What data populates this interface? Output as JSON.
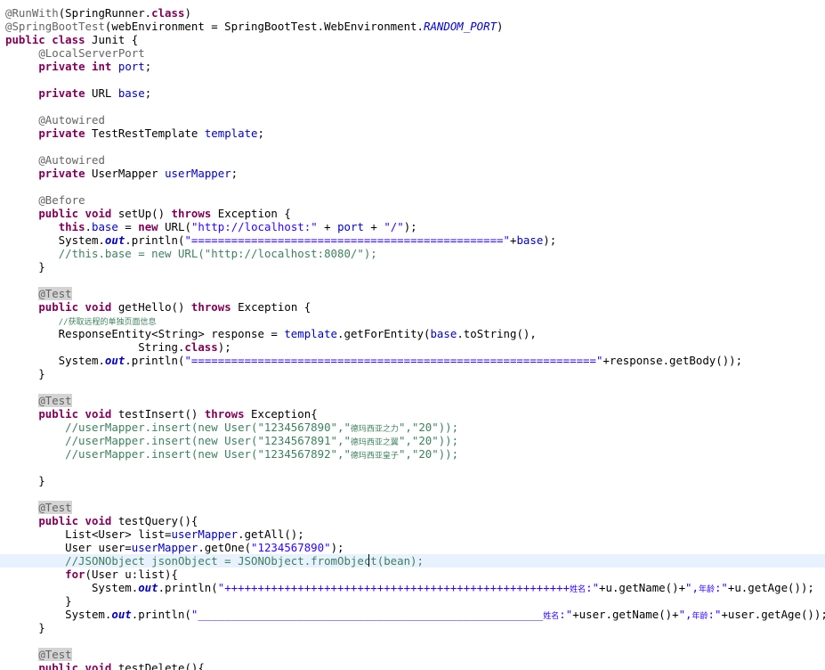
{
  "editor": {
    "lines": [
      [
        {
          "t": "@RunWith",
          "c": "an"
        },
        {
          "t": "(SpringRunner.",
          "c": "pl"
        },
        {
          "t": "class",
          "c": "kw"
        },
        {
          "t": ")",
          "c": "pl"
        }
      ],
      [
        {
          "t": "@SpringBootTest",
          "c": "an"
        },
        {
          "t": "(webEnvironment = SpringBootTest.WebEnvironment.",
          "c": "pl"
        },
        {
          "t": "RANDOM_PORT",
          "c": "sfi"
        },
        {
          "t": ")",
          "c": "pl"
        }
      ],
      [
        {
          "t": "public",
          "c": "kw"
        },
        {
          "t": " ",
          "c": "pl"
        },
        {
          "t": "class",
          "c": "kw"
        },
        {
          "t": " Junit {",
          "c": "pl"
        }
      ],
      [
        {
          "t": "     ",
          "c": "pl"
        },
        {
          "t": "@LocalServerPort",
          "c": "an"
        }
      ],
      [
        {
          "t": "     ",
          "c": "pl"
        },
        {
          "t": "private",
          "c": "kw"
        },
        {
          "t": " ",
          "c": "pl"
        },
        {
          "t": "int",
          "c": "kw"
        },
        {
          "t": " ",
          "c": "pl"
        },
        {
          "t": "port",
          "c": "fld"
        },
        {
          "t": ";",
          "c": "pl"
        }
      ],
      [],
      [
        {
          "t": "     ",
          "c": "pl"
        },
        {
          "t": "private",
          "c": "kw"
        },
        {
          "t": " URL ",
          "c": "pl"
        },
        {
          "t": "base",
          "c": "fld"
        },
        {
          "t": ";",
          "c": "pl"
        }
      ],
      [],
      [
        {
          "t": "     ",
          "c": "pl"
        },
        {
          "t": "@Autowired",
          "c": "an"
        }
      ],
      [
        {
          "t": "     ",
          "c": "pl"
        },
        {
          "t": "private",
          "c": "kw"
        },
        {
          "t": " TestRestTemplate ",
          "c": "pl"
        },
        {
          "t": "template",
          "c": "fld"
        },
        {
          "t": ";",
          "c": "pl"
        }
      ],
      [],
      [
        {
          "t": "     ",
          "c": "pl"
        },
        {
          "t": "@Autowired",
          "c": "an"
        }
      ],
      [
        {
          "t": "     ",
          "c": "pl"
        },
        {
          "t": "private",
          "c": "kw"
        },
        {
          "t": " UserMapper ",
          "c": "pl"
        },
        {
          "t": "userMapper",
          "c": "fld"
        },
        {
          "t": ";",
          "c": "pl"
        }
      ],
      [],
      [
        {
          "t": "     ",
          "c": "pl"
        },
        {
          "t": "@Before",
          "c": "an"
        }
      ],
      [
        {
          "t": "     ",
          "c": "pl"
        },
        {
          "t": "public",
          "c": "kw"
        },
        {
          "t": " ",
          "c": "pl"
        },
        {
          "t": "void",
          "c": "kw"
        },
        {
          "t": " setUp() ",
          "c": "pl"
        },
        {
          "t": "throws",
          "c": "kw"
        },
        {
          "t": " Exception {",
          "c": "pl"
        }
      ],
      [
        {
          "t": "        ",
          "c": "pl"
        },
        {
          "t": "this",
          "c": "kw"
        },
        {
          "t": ".",
          "c": "pl"
        },
        {
          "t": "base",
          "c": "fld"
        },
        {
          "t": " = ",
          "c": "pl"
        },
        {
          "t": "new",
          "c": "kw"
        },
        {
          "t": " URL(",
          "c": "pl"
        },
        {
          "t": "\"http://localhost:\"",
          "c": "str"
        },
        {
          "t": " + ",
          "c": "pl"
        },
        {
          "t": "port",
          "c": "fld"
        },
        {
          "t": " + ",
          "c": "pl"
        },
        {
          "t": "\"/\"",
          "c": "str"
        },
        {
          "t": ");",
          "c": "pl"
        }
      ],
      [
        {
          "t": "        System.",
          "c": "pl"
        },
        {
          "t": "out",
          "c": "sfld"
        },
        {
          "t": ".println(",
          "c": "pl"
        },
        {
          "t": "\"===============================================\"",
          "c": "str"
        },
        {
          "t": "+",
          "c": "pl"
        },
        {
          "t": "base",
          "c": "fld"
        },
        {
          "t": ");",
          "c": "pl"
        }
      ],
      [
        {
          "t": "        ",
          "c": "pl"
        },
        {
          "t": "//this.base = new URL(\"http://localhost:8080/\");",
          "c": "com"
        }
      ],
      [
        {
          "t": "     }",
          "c": "pl"
        }
      ],
      [],
      [
        {
          "t": "     ",
          "c": "pl"
        },
        {
          "t": "@Test",
          "c": "an-hl"
        }
      ],
      [
        {
          "t": "     ",
          "c": "pl"
        },
        {
          "t": "public",
          "c": "kw"
        },
        {
          "t": " ",
          "c": "pl"
        },
        {
          "t": "void",
          "c": "kw"
        },
        {
          "t": " getHello() ",
          "c": "pl"
        },
        {
          "t": "throws",
          "c": "kw"
        },
        {
          "t": " Exception {",
          "c": "pl"
        }
      ],
      [
        {
          "t": "        ",
          "c": "pl"
        },
        {
          "t": "//获取远程的单独页面信息",
          "c": "com",
          "s": "cjk"
        }
      ],
      [
        {
          "t": "        ResponseEntity<String> ",
          "c": "pl"
        },
        {
          "t": "response",
          "c": "pl"
        },
        {
          "t": " = ",
          "c": "pl"
        },
        {
          "t": "template",
          "c": "fld"
        },
        {
          "t": ".getForEntity(",
          "c": "pl"
        },
        {
          "t": "base",
          "c": "fld"
        },
        {
          "t": ".toString(),",
          "c": "pl"
        }
      ],
      [
        {
          "t": "                    String.",
          "c": "pl"
        },
        {
          "t": "class",
          "c": "kw"
        },
        {
          "t": ");",
          "c": "pl"
        }
      ],
      [
        {
          "t": "        System.",
          "c": "pl"
        },
        {
          "t": "out",
          "c": "sfld"
        },
        {
          "t": ".println(",
          "c": "pl"
        },
        {
          "t": "\"=============================================================\"",
          "c": "str"
        },
        {
          "t": "+",
          "c": "pl"
        },
        {
          "t": "response",
          "c": "pl"
        },
        {
          "t": ".getBody());",
          "c": "pl"
        }
      ],
      [
        {
          "t": "     }",
          "c": "pl"
        }
      ],
      [],
      [
        {
          "t": "     ",
          "c": "pl"
        },
        {
          "t": "@Test",
          "c": "an-hl"
        }
      ],
      [
        {
          "t": "     ",
          "c": "pl"
        },
        {
          "t": "public",
          "c": "kw"
        },
        {
          "t": " ",
          "c": "pl"
        },
        {
          "t": "void",
          "c": "kw"
        },
        {
          "t": " testInsert() ",
          "c": "pl"
        },
        {
          "t": "throws",
          "c": "kw"
        },
        {
          "t": " Exception{",
          "c": "pl"
        }
      ],
      [
        {
          "t": "         ",
          "c": "pl"
        },
        {
          "t": "//userMapper.insert(new User(\"1234567890\",\"",
          "c": "com"
        },
        {
          "t": "德玛西亚之力",
          "c": "com",
          "s": "cjk"
        },
        {
          "t": "\",\"20\"));",
          "c": "com"
        }
      ],
      [
        {
          "t": "         ",
          "c": "pl"
        },
        {
          "t": "//userMapper.insert(new User(\"1234567891\",\"",
          "c": "com"
        },
        {
          "t": "德玛西亚之翼",
          "c": "com",
          "s": "cjk"
        },
        {
          "t": "\",\"20\"));",
          "c": "com"
        }
      ],
      [
        {
          "t": "         ",
          "c": "pl"
        },
        {
          "t": "//userMapper.insert(new User(\"1234567892\",\"",
          "c": "com"
        },
        {
          "t": "德玛西亚皇子",
          "c": "com",
          "s": "cjk"
        },
        {
          "t": "\",\"20\"));",
          "c": "com"
        }
      ],
      [],
      [
        {
          "t": "     }",
          "c": "pl"
        }
      ],
      [],
      [
        {
          "t": "     ",
          "c": "pl"
        },
        {
          "t": "@Test",
          "c": "an-hl"
        }
      ],
      [
        {
          "t": "     ",
          "c": "pl"
        },
        {
          "t": "public",
          "c": "kw"
        },
        {
          "t": " ",
          "c": "pl"
        },
        {
          "t": "void",
          "c": "kw"
        },
        {
          "t": " testQuery(){",
          "c": "pl"
        }
      ],
      [
        {
          "t": "         List<User> ",
          "c": "pl"
        },
        {
          "t": "list",
          "c": "pl"
        },
        {
          "t": "=",
          "c": "pl"
        },
        {
          "t": "userMapper",
          "c": "fld"
        },
        {
          "t": ".getAll();",
          "c": "pl"
        }
      ],
      [
        {
          "t": "         User ",
          "c": "pl"
        },
        {
          "t": "user",
          "c": "pl"
        },
        {
          "t": "=",
          "c": "pl"
        },
        {
          "t": "userMapper",
          "c": "fld"
        },
        {
          "t": ".getOne(",
          "c": "pl"
        },
        {
          "t": "\"1234567890\"",
          "c": "str"
        },
        {
          "t": ");",
          "c": "pl"
        }
      ],
      [
        {
          "t": "         ",
          "c": "pl"
        },
        {
          "t": "//JSONObject jsonObject = JSONObject.fromObject(bean);",
          "c": "com"
        }
      ],
      [
        {
          "t": "         ",
          "c": "pl"
        },
        {
          "t": "for",
          "c": "kw"
        },
        {
          "t": "(User u:list){",
          "c": "pl"
        }
      ],
      [
        {
          "t": "             System.",
          "c": "pl"
        },
        {
          "t": "out",
          "c": "sfld"
        },
        {
          "t": ".println(",
          "c": "pl"
        },
        {
          "t": "\"++++++++++++++++++++++++++++++++++++++++++++++++++++",
          "c": "str"
        },
        {
          "t": "姓名",
          "c": "str",
          "s": "cjk"
        },
        {
          "t": ":\"",
          "c": "str"
        },
        {
          "t": "+u.getName()+",
          "c": "pl"
        },
        {
          "t": "\",",
          "c": "str"
        },
        {
          "t": "年龄",
          "c": "str",
          "s": "cjk"
        },
        {
          "t": ":\"",
          "c": "str"
        },
        {
          "t": "+u.getAge());",
          "c": "pl"
        }
      ],
      [
        {
          "t": "         }",
          "c": "pl"
        }
      ],
      [
        {
          "t": "         System.",
          "c": "pl"
        },
        {
          "t": "out",
          "c": "sfld"
        },
        {
          "t": ".println(",
          "c": "pl"
        },
        {
          "t": "\"____________________________________________________",
          "c": "str"
        },
        {
          "t": "姓名",
          "c": "str",
          "s": "cjk"
        },
        {
          "t": ":\"",
          "c": "str"
        },
        {
          "t": "+",
          "c": "pl"
        },
        {
          "t": "user",
          "c": "pl"
        },
        {
          "t": ".getName()+",
          "c": "pl"
        },
        {
          "t": "\",",
          "c": "str"
        },
        {
          "t": "年龄",
          "c": "str",
          "s": "cjk"
        },
        {
          "t": ":\"",
          "c": "str"
        },
        {
          "t": "+",
          "c": "pl"
        },
        {
          "t": "user",
          "c": "pl"
        },
        {
          "t": ".getAge());",
          "c": "pl"
        }
      ],
      [
        {
          "t": "     }",
          "c": "pl"
        }
      ],
      [],
      [
        {
          "t": "     ",
          "c": "pl"
        },
        {
          "t": "@Test",
          "c": "an-hl"
        }
      ],
      [
        {
          "t": "     ",
          "c": "pl"
        },
        {
          "t": "public",
          "c": "kw"
        },
        {
          "t": " ",
          "c": "pl"
        },
        {
          "t": "void",
          "c": "kw"
        },
        {
          "t": " testDelete(){",
          "c": "pl"
        }
      ]
    ]
  }
}
